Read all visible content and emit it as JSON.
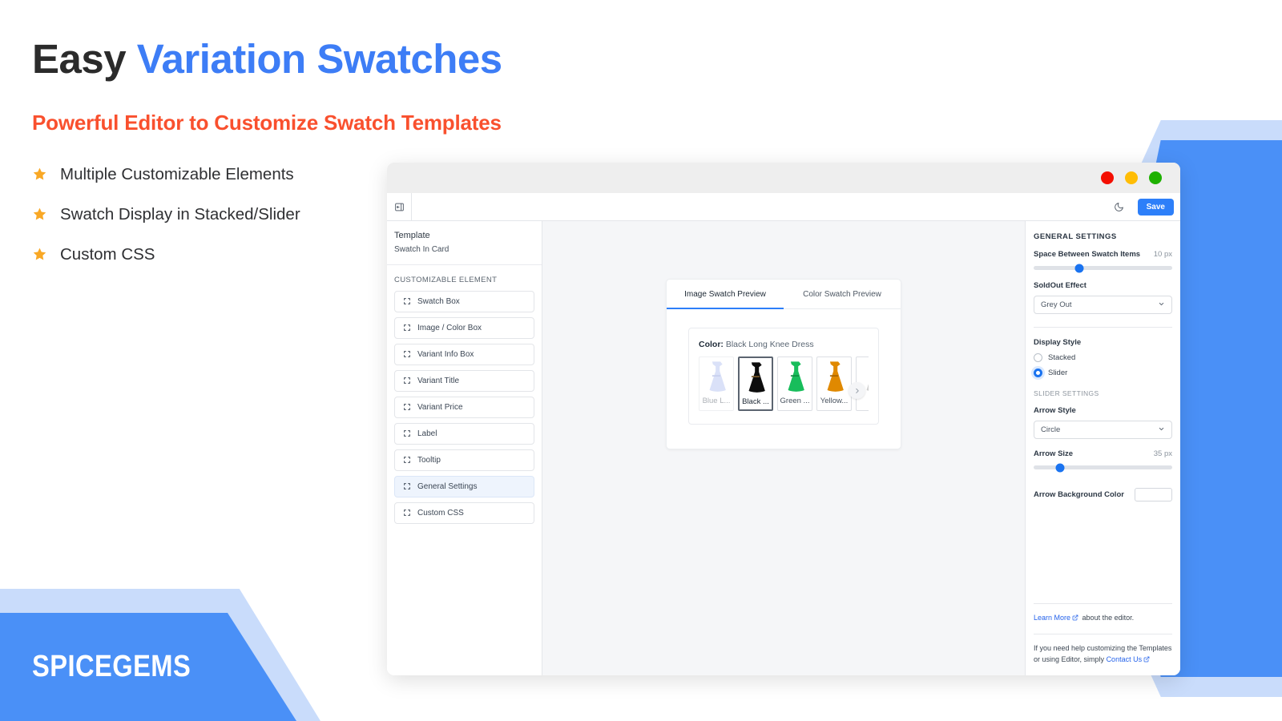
{
  "promo": {
    "headline_plain": "Easy ",
    "headline_accent": "Variation Swatches",
    "subheadline": "Powerful Editor to Customize Swatch Templates",
    "features": [
      {
        "icon": "star-icon",
        "text": "Multiple Customizable Elements"
      },
      {
        "icon": "star-icon",
        "text": "Swatch Display in Stacked/Slider"
      },
      {
        "icon": "star-icon",
        "text": "Custom CSS"
      }
    ],
    "brand": "SPICEGEMS",
    "colors": {
      "accent_blue": "#3d7df6",
      "accent_orange": "#f9502e",
      "star_gold": "#f9a825",
      "brand_blue": "#4a90f7",
      "brand_light_blue": "#c9dcfb"
    }
  },
  "window": {
    "traffic_lights": [
      "close-dot-red",
      "minimize-dot-yellow",
      "maximize-dot-green"
    ],
    "toolbar": {
      "collapse_icon": "panel-collapse-icon",
      "theme_icon": "moon-icon",
      "save_label": "Save"
    }
  },
  "left_pane": {
    "template_label": "Template",
    "template_value": "Swatch In Card",
    "section_title": "CUSTOMIZABLE ELEMENT",
    "items": [
      {
        "label": "Swatch Box",
        "active": false
      },
      {
        "label": "Image / Color Box",
        "active": false
      },
      {
        "label": "Variant Info Box",
        "active": false
      },
      {
        "label": "Variant Title",
        "active": false
      },
      {
        "label": "Variant Price",
        "active": false
      },
      {
        "label": "Label",
        "active": false
      },
      {
        "label": "Tooltip",
        "active": false
      },
      {
        "label": "General Settings",
        "active": true
      },
      {
        "label": "Custom CSS",
        "active": false
      }
    ]
  },
  "center_pane": {
    "tabs": [
      {
        "label": "Image Swatch Preview",
        "active": true
      },
      {
        "label": "Color Swatch Preview",
        "active": false
      }
    ],
    "attribute_label": "Color:",
    "attribute_value": "Black Long Knee Dress",
    "swatches": [
      {
        "name": "Blue L...",
        "color": "#aebef0",
        "selected": false,
        "soldout": true
      },
      {
        "name": "Black ...",
        "color": "#0d0d0d",
        "selected": true,
        "soldout": false
      },
      {
        "name": "Green ...",
        "color": "#18bd5b",
        "selected": false,
        "soldout": false
      },
      {
        "name": "Yellow...",
        "color": "#e08900",
        "selected": false,
        "soldout": false
      },
      {
        "name": "",
        "color": "#cfcfcf",
        "selected": false,
        "soldout": false
      }
    ],
    "next_arrow_icon": "chevron-right-icon"
  },
  "right_pane": {
    "title": "GENERAL SETTINGS",
    "space_between": {
      "label": "Space Between Swatch Items",
      "value": "10 px",
      "percent": 33
    },
    "soldout_effect": {
      "label": "SoldOut Effect",
      "value": "Grey Out"
    },
    "display_style": {
      "label": "Display Style",
      "options": [
        {
          "label": "Stacked",
          "selected": false
        },
        {
          "label": "Slider",
          "selected": true
        }
      ]
    },
    "slider_settings_title": "SLIDER SETTINGS",
    "arrow_style": {
      "label": "Arrow Style",
      "value": "Circle"
    },
    "arrow_size": {
      "label": "Arrow Size",
      "value": "35 px",
      "percent": 19
    },
    "arrow_bg_color": {
      "label": "Arrow Background Color",
      "value": "#ffffff"
    },
    "footer": {
      "learn_more_link": "Learn More",
      "learn_more_tail": "about the editor.",
      "help_text": "If you need help customizing the Templates or using Editor, simply",
      "contact_link": "Contact Us",
      "external_icon": "external-link-icon"
    }
  }
}
